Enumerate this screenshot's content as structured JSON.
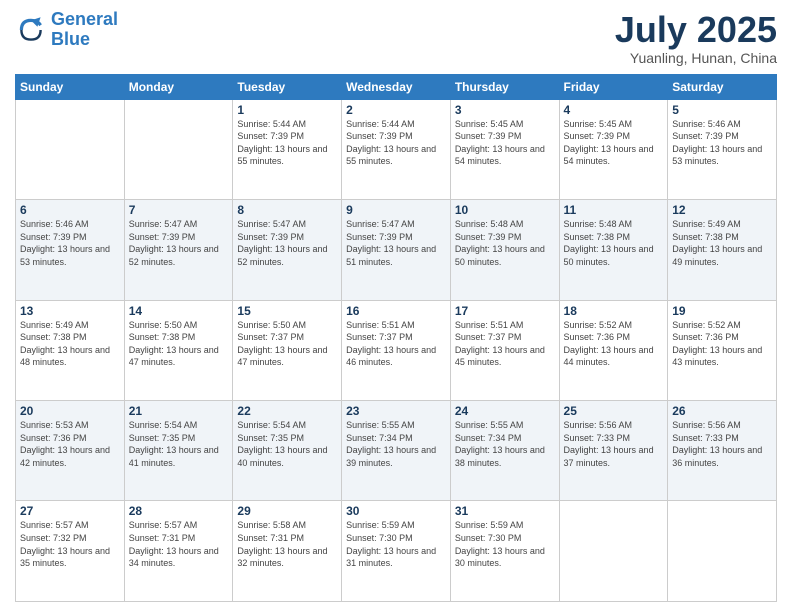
{
  "logo": {
    "line1": "General",
    "line2": "Blue"
  },
  "title": "July 2025",
  "subtitle": "Yuanling, Hunan, China",
  "days_header": [
    "Sunday",
    "Monday",
    "Tuesday",
    "Wednesday",
    "Thursday",
    "Friday",
    "Saturday"
  ],
  "weeks": [
    [
      {
        "day": "",
        "info": ""
      },
      {
        "day": "",
        "info": ""
      },
      {
        "day": "1",
        "info": "Sunrise: 5:44 AM\nSunset: 7:39 PM\nDaylight: 13 hours and 55 minutes."
      },
      {
        "day": "2",
        "info": "Sunrise: 5:44 AM\nSunset: 7:39 PM\nDaylight: 13 hours and 55 minutes."
      },
      {
        "day": "3",
        "info": "Sunrise: 5:45 AM\nSunset: 7:39 PM\nDaylight: 13 hours and 54 minutes."
      },
      {
        "day": "4",
        "info": "Sunrise: 5:45 AM\nSunset: 7:39 PM\nDaylight: 13 hours and 54 minutes."
      },
      {
        "day": "5",
        "info": "Sunrise: 5:46 AM\nSunset: 7:39 PM\nDaylight: 13 hours and 53 minutes."
      }
    ],
    [
      {
        "day": "6",
        "info": "Sunrise: 5:46 AM\nSunset: 7:39 PM\nDaylight: 13 hours and 53 minutes."
      },
      {
        "day": "7",
        "info": "Sunrise: 5:47 AM\nSunset: 7:39 PM\nDaylight: 13 hours and 52 minutes."
      },
      {
        "day": "8",
        "info": "Sunrise: 5:47 AM\nSunset: 7:39 PM\nDaylight: 13 hours and 52 minutes."
      },
      {
        "day": "9",
        "info": "Sunrise: 5:47 AM\nSunset: 7:39 PM\nDaylight: 13 hours and 51 minutes."
      },
      {
        "day": "10",
        "info": "Sunrise: 5:48 AM\nSunset: 7:39 PM\nDaylight: 13 hours and 50 minutes."
      },
      {
        "day": "11",
        "info": "Sunrise: 5:48 AM\nSunset: 7:38 PM\nDaylight: 13 hours and 50 minutes."
      },
      {
        "day": "12",
        "info": "Sunrise: 5:49 AM\nSunset: 7:38 PM\nDaylight: 13 hours and 49 minutes."
      }
    ],
    [
      {
        "day": "13",
        "info": "Sunrise: 5:49 AM\nSunset: 7:38 PM\nDaylight: 13 hours and 48 minutes."
      },
      {
        "day": "14",
        "info": "Sunrise: 5:50 AM\nSunset: 7:38 PM\nDaylight: 13 hours and 47 minutes."
      },
      {
        "day": "15",
        "info": "Sunrise: 5:50 AM\nSunset: 7:37 PM\nDaylight: 13 hours and 47 minutes."
      },
      {
        "day": "16",
        "info": "Sunrise: 5:51 AM\nSunset: 7:37 PM\nDaylight: 13 hours and 46 minutes."
      },
      {
        "day": "17",
        "info": "Sunrise: 5:51 AM\nSunset: 7:37 PM\nDaylight: 13 hours and 45 minutes."
      },
      {
        "day": "18",
        "info": "Sunrise: 5:52 AM\nSunset: 7:36 PM\nDaylight: 13 hours and 44 minutes."
      },
      {
        "day": "19",
        "info": "Sunrise: 5:52 AM\nSunset: 7:36 PM\nDaylight: 13 hours and 43 minutes."
      }
    ],
    [
      {
        "day": "20",
        "info": "Sunrise: 5:53 AM\nSunset: 7:36 PM\nDaylight: 13 hours and 42 minutes."
      },
      {
        "day": "21",
        "info": "Sunrise: 5:54 AM\nSunset: 7:35 PM\nDaylight: 13 hours and 41 minutes."
      },
      {
        "day": "22",
        "info": "Sunrise: 5:54 AM\nSunset: 7:35 PM\nDaylight: 13 hours and 40 minutes."
      },
      {
        "day": "23",
        "info": "Sunrise: 5:55 AM\nSunset: 7:34 PM\nDaylight: 13 hours and 39 minutes."
      },
      {
        "day": "24",
        "info": "Sunrise: 5:55 AM\nSunset: 7:34 PM\nDaylight: 13 hours and 38 minutes."
      },
      {
        "day": "25",
        "info": "Sunrise: 5:56 AM\nSunset: 7:33 PM\nDaylight: 13 hours and 37 minutes."
      },
      {
        "day": "26",
        "info": "Sunrise: 5:56 AM\nSunset: 7:33 PM\nDaylight: 13 hours and 36 minutes."
      }
    ],
    [
      {
        "day": "27",
        "info": "Sunrise: 5:57 AM\nSunset: 7:32 PM\nDaylight: 13 hours and 35 minutes."
      },
      {
        "day": "28",
        "info": "Sunrise: 5:57 AM\nSunset: 7:31 PM\nDaylight: 13 hours and 34 minutes."
      },
      {
        "day": "29",
        "info": "Sunrise: 5:58 AM\nSunset: 7:31 PM\nDaylight: 13 hours and 32 minutes."
      },
      {
        "day": "30",
        "info": "Sunrise: 5:59 AM\nSunset: 7:30 PM\nDaylight: 13 hours and 31 minutes."
      },
      {
        "day": "31",
        "info": "Sunrise: 5:59 AM\nSunset: 7:30 PM\nDaylight: 13 hours and 30 minutes."
      },
      {
        "day": "",
        "info": ""
      },
      {
        "day": "",
        "info": ""
      }
    ]
  ]
}
